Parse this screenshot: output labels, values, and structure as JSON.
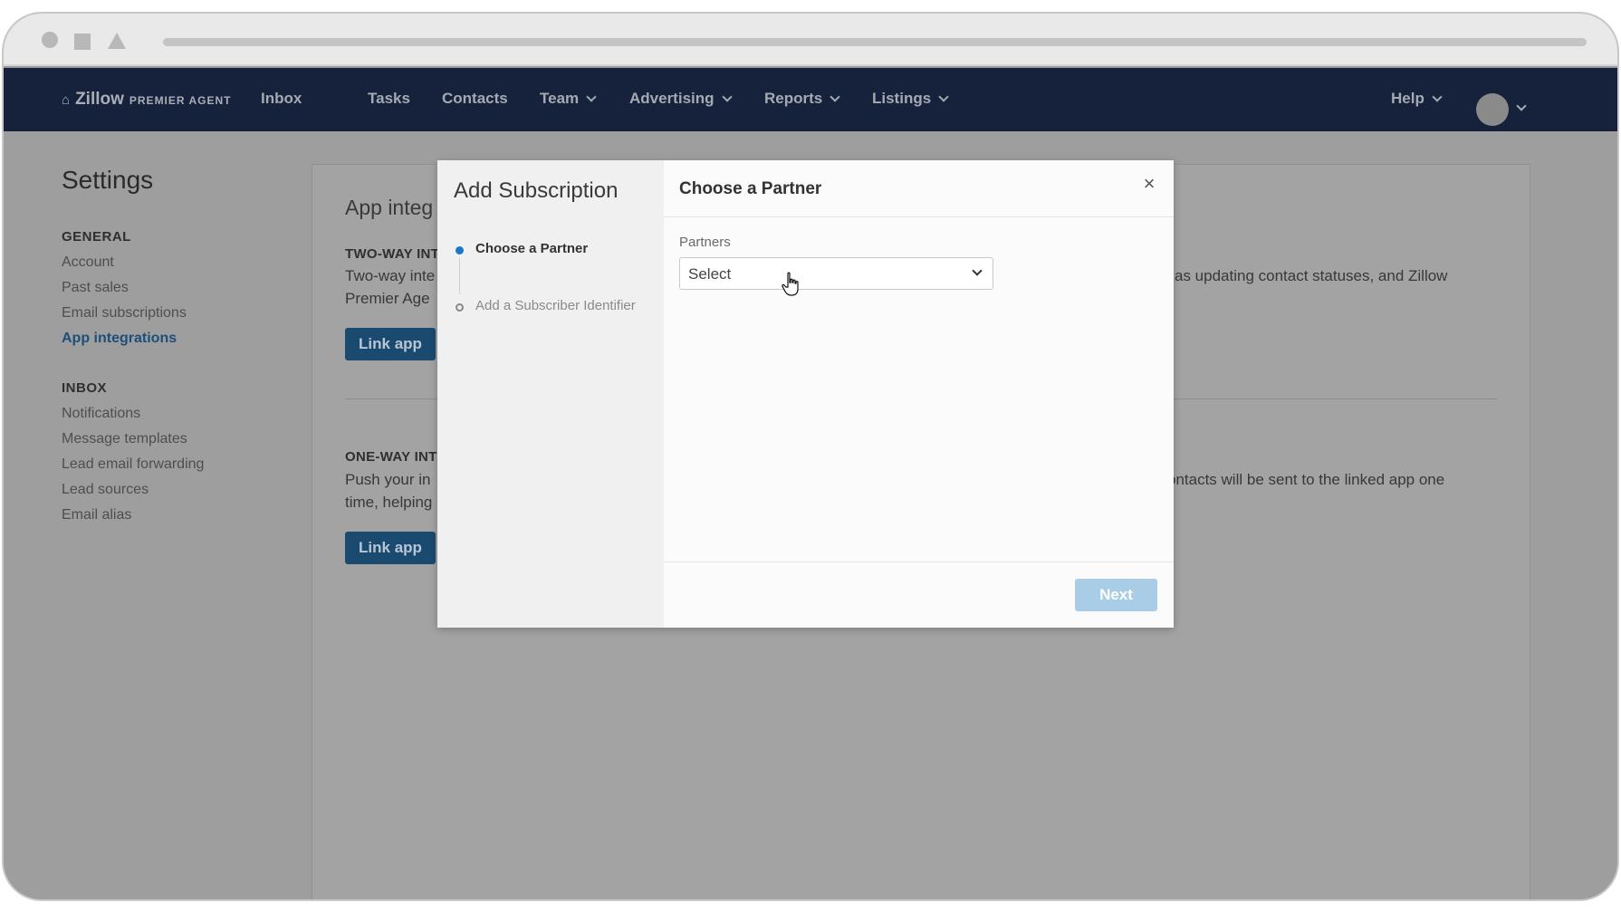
{
  "nav": {
    "logo_main": "Zillow",
    "logo_sub": "PREMIER AGENT",
    "items": [
      "Inbox",
      "Tasks",
      "Contacts",
      "Team",
      "Advertising",
      "Reports",
      "Listings"
    ],
    "help": "Help"
  },
  "sidebar": {
    "title": "Settings",
    "general_heading": "GENERAL",
    "general_items": [
      "Account",
      "Past sales",
      "Email subscriptions",
      "App integrations"
    ],
    "inbox_heading": "INBOX",
    "inbox_items": [
      "Notifications",
      "Message templates",
      "Lead email forwarding",
      "Lead sources",
      "Email alias"
    ]
  },
  "content": {
    "title": "App integ",
    "two_way_heading": "TWO-WAY INT",
    "two_way_text_left_1": "Two-way inte",
    "two_way_text_left_2": "Premier Age",
    "two_way_text_right": "as updating contact statuses, and Zillow",
    "link_app_1": "Link app",
    "one_way_heading": "ONE-WAY INT",
    "one_way_text_left_1": "Push your in",
    "one_way_text_left_2": "time, helping",
    "one_way_text_right": "ontacts will be sent to the linked app one",
    "link_app_2": "Link app"
  },
  "modal": {
    "heading": "Add Subscription",
    "steps": [
      "Choose a Partner",
      "Add a Subscriber Identifier"
    ],
    "right_title": "Choose a Partner",
    "close": "×",
    "partners_label": "Partners",
    "select_value": "Select",
    "next": "Next"
  }
}
